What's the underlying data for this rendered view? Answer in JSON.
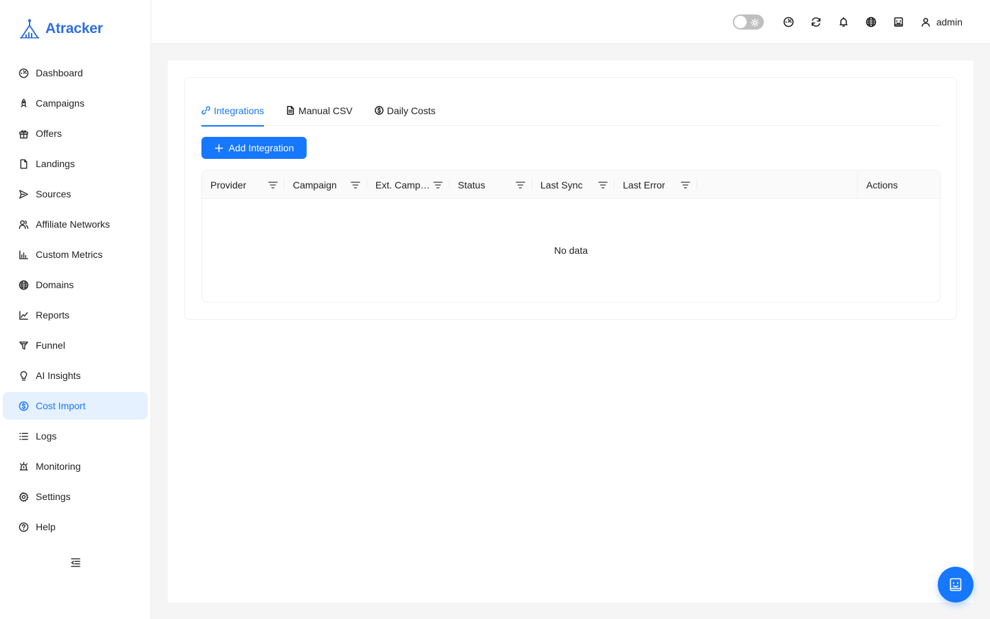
{
  "app": {
    "name": "Atracker",
    "accent": "#1677ff",
    "brand": "#2f6fe0"
  },
  "sidebar": {
    "items": [
      {
        "label": "Dashboard",
        "icon": "dashboard-icon"
      },
      {
        "label": "Campaigns",
        "icon": "rocket-icon"
      },
      {
        "label": "Offers",
        "icon": "gift-icon"
      },
      {
        "label": "Landings",
        "icon": "file-icon"
      },
      {
        "label": "Sources",
        "icon": "send-icon"
      },
      {
        "label": "Affiliate Networks",
        "icon": "users-icon"
      },
      {
        "label": "Custom Metrics",
        "icon": "bar-chart-icon"
      },
      {
        "label": "Domains",
        "icon": "globe-icon"
      },
      {
        "label": "Reports",
        "icon": "line-chart-icon"
      },
      {
        "label": "Funnel",
        "icon": "funnel-icon"
      },
      {
        "label": "AI Insights",
        "icon": "bulb-icon"
      },
      {
        "label": "Cost Import",
        "icon": "dollar-icon",
        "active": true
      },
      {
        "label": "Logs",
        "icon": "list-icon"
      },
      {
        "label": "Monitoring",
        "icon": "alarm-icon"
      },
      {
        "label": "Settings",
        "icon": "gear-icon"
      },
      {
        "label": "Help",
        "icon": "question-icon"
      }
    ]
  },
  "header": {
    "user": "admin"
  },
  "tabs": [
    {
      "label": "Integrations",
      "icon": "link-icon",
      "active": true
    },
    {
      "label": "Manual CSV",
      "icon": "file-text-icon"
    },
    {
      "label": "Daily Costs",
      "icon": "dollar-icon"
    }
  ],
  "toolbar": {
    "add_label": "Add Integration"
  },
  "table": {
    "columns": [
      "Provider",
      "Campaign",
      "Ext. Campaign ID",
      "Status",
      "Last Sync",
      "Last Error"
    ],
    "actions_label": "Actions",
    "empty_text": "No data"
  }
}
